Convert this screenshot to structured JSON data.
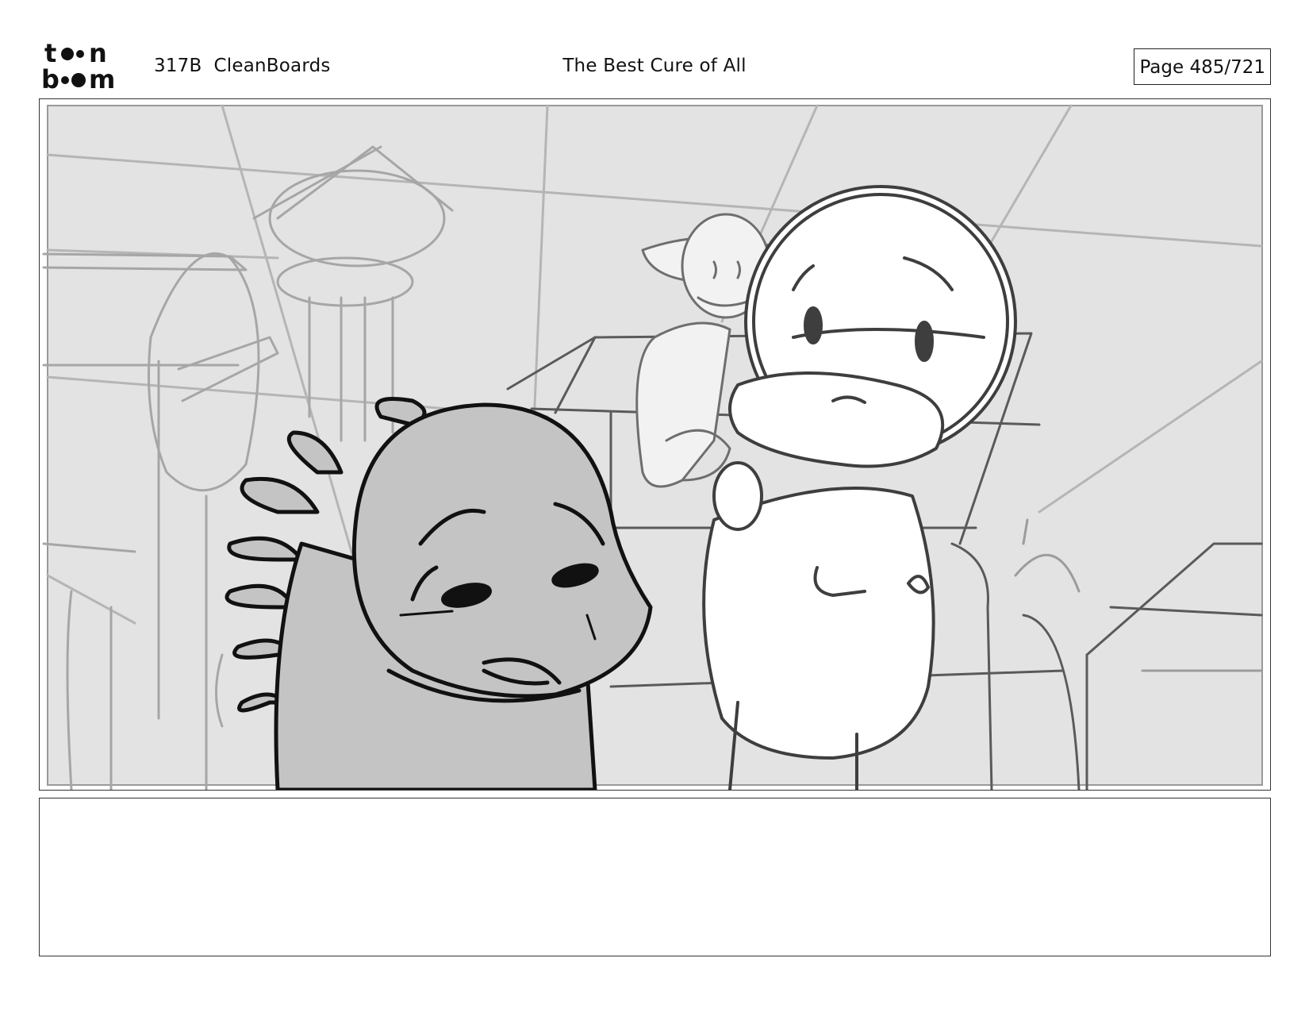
{
  "header": {
    "logo_text": "toon boom",
    "project": "317B  CleanBoards",
    "title": "The Best Cure of All",
    "page_label": "Page 485/721"
  },
  "panel": {
    "image": "storyboard-sketch",
    "colors": {
      "background": "#e3e3e3",
      "foreground_character": "#c4c4c4",
      "sketch_light": "#a8a8a8",
      "sketch_mid": "#555555",
      "sketch_dark": "#111111"
    }
  },
  "notes": {
    "text": ""
  }
}
